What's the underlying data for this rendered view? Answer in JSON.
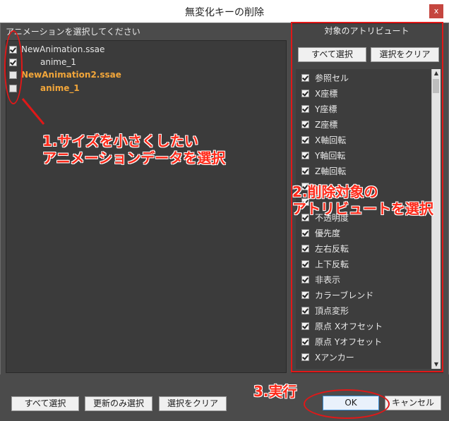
{
  "window": {
    "title": "無変化キーの削除",
    "close_label": "x"
  },
  "left": {
    "header": "アニメーションを選択してください",
    "items": [
      {
        "label": "NewAnimation.ssae",
        "checked": true,
        "highlight": false,
        "indent": 0
      },
      {
        "label": "anime_1",
        "checked": true,
        "highlight": false,
        "indent": 1
      },
      {
        "label": "NewAnimation2.ssae",
        "checked": false,
        "highlight": true,
        "indent": 0
      },
      {
        "label": "anime_1",
        "checked": false,
        "highlight": true,
        "indent": 1
      }
    ]
  },
  "right": {
    "header": "対象のアトリビュート",
    "select_all": "すべて選択",
    "clear": "選択をクリア",
    "attributes": [
      "参照セル",
      "X座標",
      "Y座標",
      "Z座標",
      "X軸回転",
      "Y軸回転",
      "Z軸回転",
      "",
      "",
      "不透明度",
      "優先度",
      "左右反転",
      "上下反転",
      "非表示",
      "カラーブレンド",
      "頂点変形",
      "原点 Xオフセット",
      "原点 Yオフセット",
      "Xアンカー"
    ]
  },
  "bottom": {
    "select_all": "すべて選択",
    "select_updated": "更新のみ選択",
    "clear": "選択をクリア",
    "ok": "OK",
    "cancel": "キャンセル"
  },
  "annotations": {
    "step1_line1": "1.サイズを小さくしたい",
    "step1_line2": "アニメーションデータを選択",
    "step2_line1": "2.削除対象の",
    "step2_line2": "アトリビュートを選択",
    "step3": "3.実行"
  },
  "colors": {
    "annotation": "#e01818",
    "highlight_item": "#f2a63a"
  }
}
